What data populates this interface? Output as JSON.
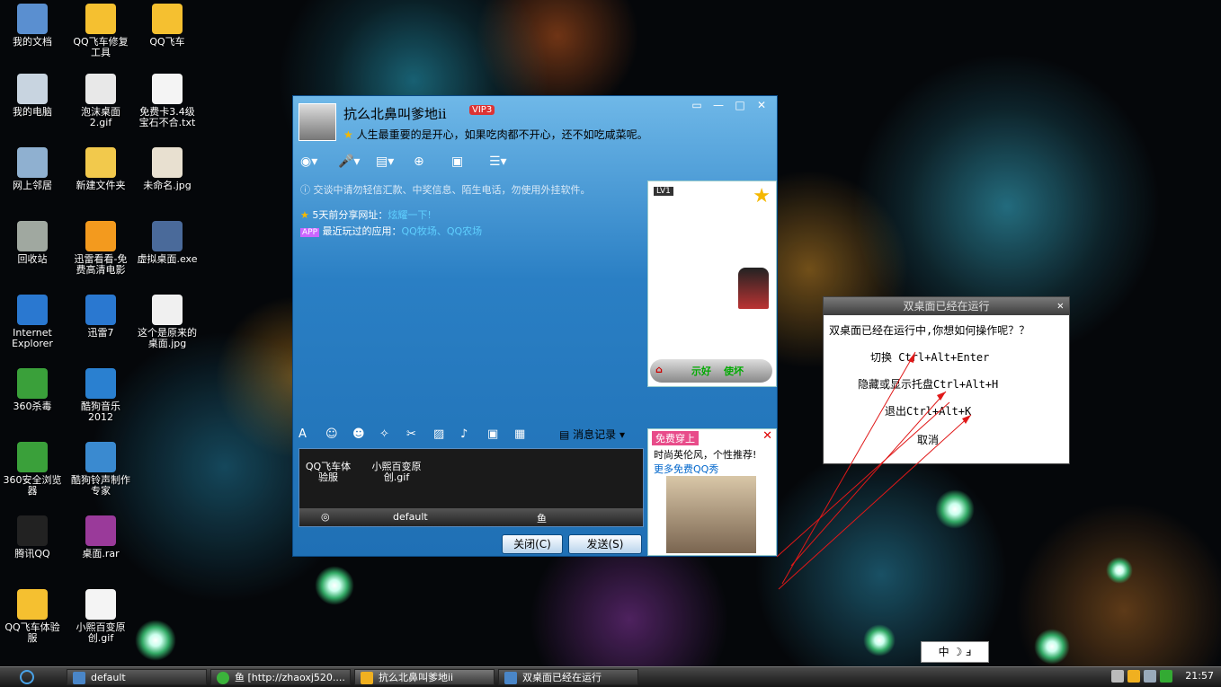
{
  "desktop": {
    "icons": [
      {
        "label": "我的文档",
        "icon": "my-documents-icon"
      },
      {
        "label": "QQ飞车修复工具",
        "icon": "qq-speed-fix-icon"
      },
      {
        "label": "QQ飞车",
        "icon": "qq-speed-icon"
      },
      {
        "label": "我的电脑",
        "icon": "my-computer-icon"
      },
      {
        "label": "泡沫桌面2.gif",
        "icon": "gif-file-icon"
      },
      {
        "label": "免费卡3.4级宝石不合.txt",
        "icon": "txt-file-icon"
      },
      {
        "label": "网上邻居",
        "icon": "network-icon"
      },
      {
        "label": "新建文件夹",
        "icon": "folder-icon"
      },
      {
        "label": "未命名.jpg",
        "icon": "jpg-file-icon"
      },
      {
        "label": "回收站",
        "icon": "recycle-bin-icon"
      },
      {
        "label": "迅雷看看-免费高清电影",
        "icon": "xunlei-kankan-icon"
      },
      {
        "label": "虚拟桌面.exe",
        "icon": "virtual-desktop-icon"
      },
      {
        "label": "Internet Explorer",
        "icon": "ie-icon"
      },
      {
        "label": "迅雷7",
        "icon": "xunlei-icon"
      },
      {
        "label": "这个是原来的桌面.jpg",
        "icon": "jpg-file-icon"
      },
      {
        "label": "360杀毒",
        "icon": "antivirus-icon"
      },
      {
        "label": "酷狗音乐2012",
        "icon": "kugou-icon"
      },
      {
        "label": "360安全浏览器",
        "icon": "browser-360-icon"
      },
      {
        "label": "酷狗铃声制作专家",
        "icon": "ringtone-icon"
      },
      {
        "label": "腾讯QQ",
        "icon": "qq-icon"
      },
      {
        "label": "桌面.rar",
        "icon": "rar-file-icon"
      },
      {
        "label": "QQ飞车体验服",
        "icon": "qq-speed-test-icon"
      },
      {
        "label": "小熙百变原创.gif",
        "icon": "gif-file-icon"
      }
    ]
  },
  "qq": {
    "nickname": "抗么北鼻叫爹地ii",
    "vip": "VIP3",
    "signature": "人生最重要的是开心，如果吃肉都不开心，还不如吃咸菜呢。",
    "notice": "交谈中请勿轻信汇款、中奖信息、陌生电话，勿使用外挂软件。",
    "share_prefix": "5天前分享网址：",
    "share_link": "炫耀一下!",
    "apps_prefix": "最近玩过的应用：",
    "apps_link": "QQ牧场、QQ农场",
    "show_level": "LV1",
    "show_star_level": "LV1",
    "show_btn1": "示好",
    "show_btn2": "使坏",
    "msg_record": "消息记录",
    "inbox_item1": "QQ飞车体验服",
    "inbox_item2": "小熙百变原创.gif",
    "inbox_task1": "default",
    "inbox_task2": "鱼 [http://zhaoxj520....",
    "close_btn": "关闭(C)",
    "send_btn": "发送(S)",
    "ad_tag": "免费穿上",
    "ad_line1": "时尚英伦风，个性推荐!",
    "ad_line2": "更多免费QQ秀"
  },
  "dialog": {
    "title": "双桌面已经在运行",
    "message": "双桌面已经在运行中,你想如何操作呢？？",
    "opt_switch": "切换 Ctrl+Alt+Enter",
    "opt_hide": "隐藏或显示托盘Ctrl+Alt+H",
    "opt_exit": "退出Ctrl+Alt+K",
    "opt_cancel": "取消"
  },
  "ime": {
    "label": "中 ☽ ⅎ"
  },
  "taskbar": {
    "tasks": [
      {
        "label": "default"
      },
      {
        "label": "鱼 [http://zhaoxj520...."
      },
      {
        "label": "抗么北鼻叫爹地ii"
      },
      {
        "label": "双桌面已经在运行"
      }
    ],
    "clock": "21:57"
  },
  "colors": {
    "qq_blue": "#2a7fc4",
    "link": "#5fd0ff",
    "dialog_bar": "#3c3c3c"
  }
}
